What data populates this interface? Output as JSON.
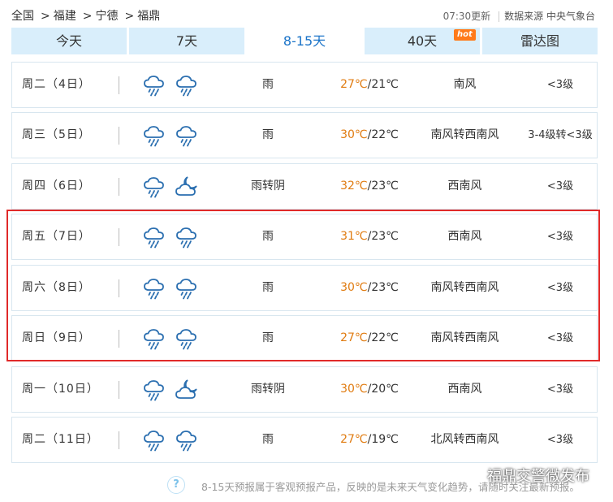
{
  "breadcrumb": [
    "全国",
    "福建",
    "宁德",
    "福鼎"
  ],
  "breadcrumb_sep": ">",
  "update": {
    "time": "07:30更新",
    "source": "数据来源 中央气象台"
  },
  "tabs": [
    {
      "label": "今天",
      "active": false
    },
    {
      "label": "7天",
      "active": false
    },
    {
      "label": "8-15天",
      "active": true
    },
    {
      "label": "40天",
      "active": false,
      "badge": "hot"
    },
    {
      "label": "雷达图",
      "active": false
    }
  ],
  "colors": {
    "accent": "#1a73c8",
    "tab_bg": "#d9eefb",
    "high_temp": "#e07b10",
    "highlight": "#e02a2a",
    "hot_badge": "#ff7a1a"
  },
  "rows": [
    {
      "day": "周二（4日）",
      "icons": [
        "rain-icon",
        "rain-icon"
      ],
      "desc": "雨",
      "hi": "27℃",
      "lo": "/21℃",
      "wind": "南风",
      "level": "<3级"
    },
    {
      "day": "周三（5日）",
      "icons": [
        "rain-icon",
        "rain-icon"
      ],
      "desc": "雨",
      "hi": "30℃",
      "lo": "/22℃",
      "wind": "南风转西南风",
      "level": "3-4级转<3级"
    },
    {
      "day": "周四（6日）",
      "icons": [
        "rain-icon",
        "cloudy-night-icon"
      ],
      "desc": "雨转阴",
      "hi": "32℃",
      "lo": "/23℃",
      "wind": "西南风",
      "level": "<3级"
    },
    {
      "day": "周五（7日）",
      "icons": [
        "rain-icon",
        "rain-icon"
      ],
      "desc": "雨",
      "hi": "31℃",
      "lo": "/23℃",
      "wind": "西南风",
      "level": "<3级"
    },
    {
      "day": "周六（8日）",
      "icons": [
        "rain-icon",
        "rain-icon"
      ],
      "desc": "雨",
      "hi": "30℃",
      "lo": "/23℃",
      "wind": "南风转西南风",
      "level": "<3级"
    },
    {
      "day": "周日（9日）",
      "icons": [
        "rain-icon",
        "rain-icon"
      ],
      "desc": "雨",
      "hi": "27℃",
      "lo": "/22℃",
      "wind": "南风转西南风",
      "level": "<3级"
    },
    {
      "day": "周一（10日）",
      "icons": [
        "rain-icon",
        "cloudy-night-icon"
      ],
      "desc": "雨转阴",
      "hi": "30℃",
      "lo": "/20℃",
      "wind": "西南风",
      "level": "<3级"
    },
    {
      "day": "周二（11日）",
      "icons": [
        "rain-icon",
        "rain-icon"
      ],
      "desc": "雨",
      "hi": "27℃",
      "lo": "/19℃",
      "wind": "北风转西南风",
      "level": "<3级"
    }
  ],
  "footer": {
    "note": "8-15天预报属于客观预报产品，反映的是未来天气变化趋势，请随时关注最新预报。"
  },
  "watermark": "福鼎交警微发布"
}
